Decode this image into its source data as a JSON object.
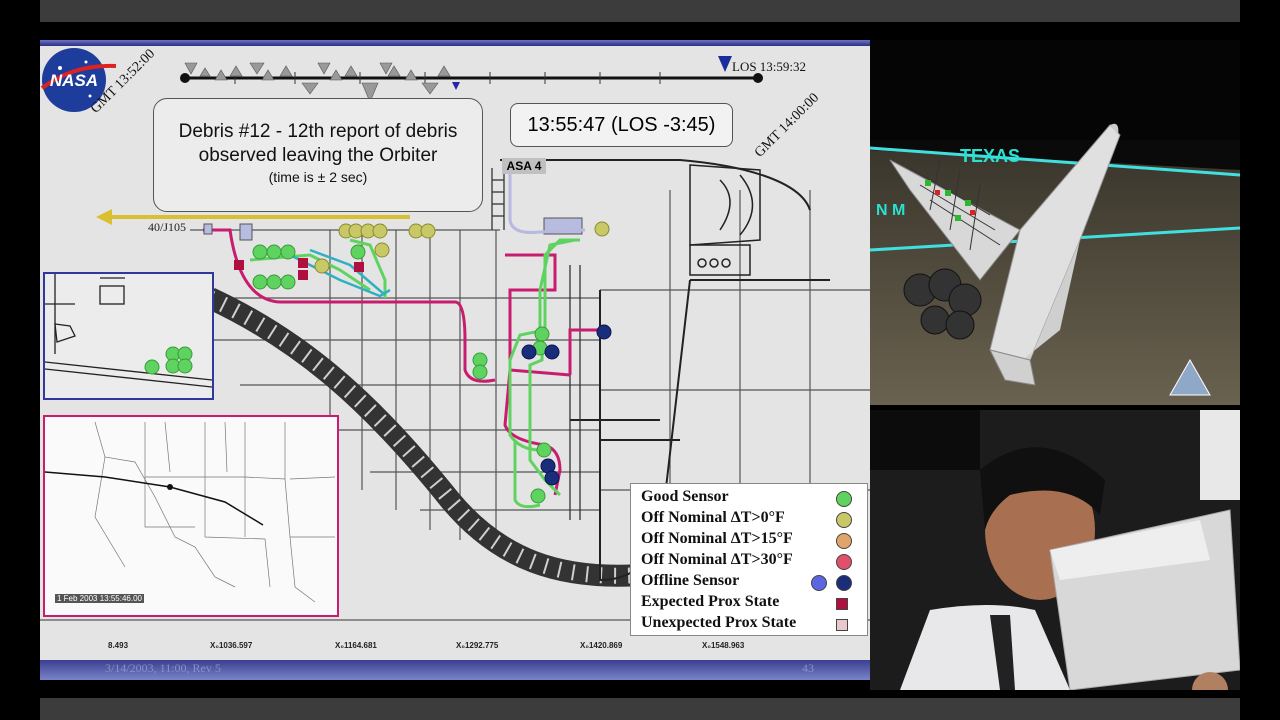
{
  "timeline": {
    "gmt_start": "GMT 13:52:00",
    "gmt_end": "GMT 14:00:00",
    "los_label": "LOS 13:59:32"
  },
  "debris_box": {
    "line1": "Debris #12 - 12th report of debris",
    "line2": "observed leaving the Orbiter",
    "note": "(time is ± 2 sec)"
  },
  "time_box": {
    "text": "13:55:47 (LOS -3:45)"
  },
  "labels": {
    "asa": "ASA 4",
    "wire": "40/J105"
  },
  "map": {
    "timestamp": "1 Feb 2003 13:55:46.00"
  },
  "legend": [
    {
      "label": "Good Sensor",
      "color": "#5fd35f",
      "shape": "circle"
    },
    {
      "label": "Off Nominal ΔT>0°F",
      "color": "#c9c866",
      "shape": "circle"
    },
    {
      "label": "Off Nominal ΔT>15°F",
      "color": "#e0a56a",
      "shape": "circle"
    },
    {
      "label": "Off Nominal ΔT>30°F",
      "color": "#e0506a",
      "shape": "circle"
    },
    {
      "label": "Offline Sensor",
      "color": "#1a2d7a",
      "color2": "#5c66e0",
      "shape": "circle"
    },
    {
      "label": "Expected Prox State",
      "color": "#b01040",
      "shape": "square"
    },
    {
      "label": "Unexpected Prox State",
      "color": "#e8c8c8",
      "shape": "square"
    }
  ],
  "x_axis": [
    "8.493",
    "X₀1036.597",
    "X₀1164.681",
    "X₀1292.775",
    "X₀1420.869",
    "X₀1548.963"
  ],
  "footer": {
    "date": "3/14/2003, 11:00, Rev 5",
    "page": "43"
  },
  "video_top": {
    "overlay": "TEXAS",
    "overlay2": "N M"
  },
  "colors": {
    "good": "#5fd35f",
    "wire": "#c81d6e",
    "offline": "#1a2d7a",
    "slide_bg": "#e4e4e4"
  }
}
